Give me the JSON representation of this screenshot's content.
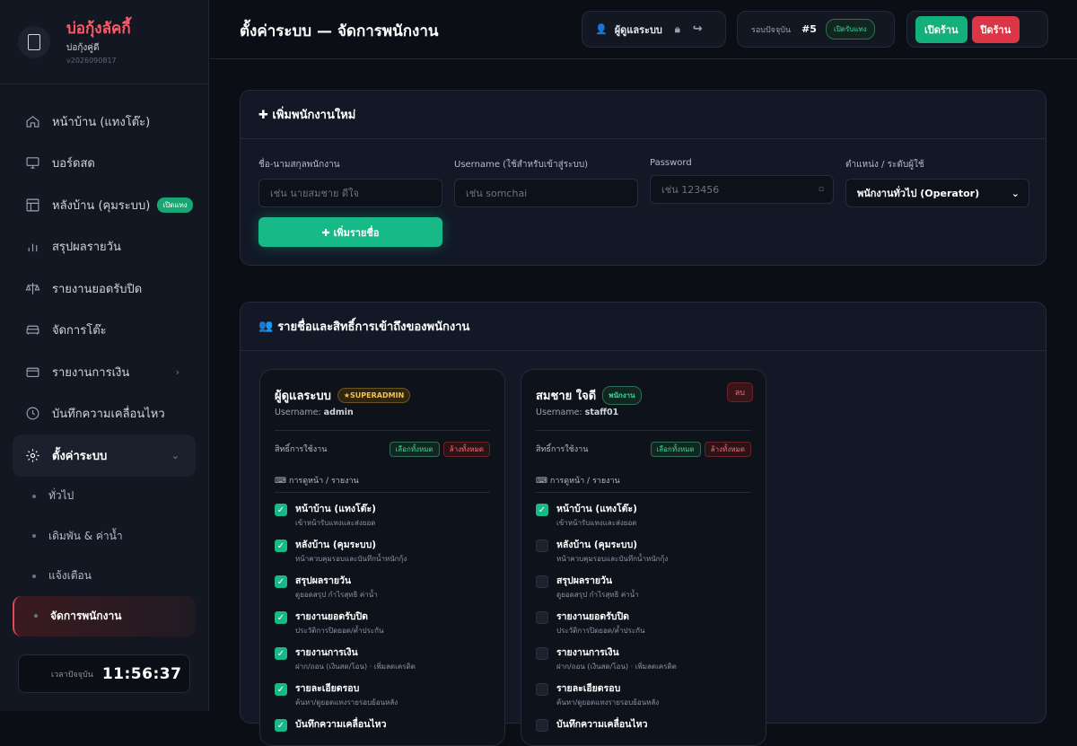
{
  "brand": {
    "title": "บ่อกุ้งลัคกี้",
    "subtitle": "บ่อกุ้งคู่ดี",
    "version": "v2026090817"
  },
  "nav": [
    {
      "label": "หน้าบ้าน (แทงโต๊ะ)",
      "icon": "home-icon"
    },
    {
      "label": "บอร์ดสด",
      "icon": "monitor-icon"
    },
    {
      "label": "หลังบ้าน (คุมระบบ)",
      "icon": "layout-icon",
      "badge": "เปิดแทง"
    },
    {
      "label": "สรุปผลรายวัน",
      "icon": "bar-chart-icon"
    },
    {
      "label": "รายงานยอดรับปิด",
      "icon": "scale-icon"
    },
    {
      "label": "จัดการโต๊ะ",
      "icon": "sofa-icon"
    },
    {
      "label": "รายงานการเงิน",
      "icon": "wallet-icon",
      "chevron": "›"
    },
    {
      "label": "บันทึกความเคลื่อนไหว",
      "icon": "clock-icon"
    },
    {
      "label": "ตั้งค่าระบบ",
      "icon": "gear-icon",
      "chevron": "⌄"
    }
  ],
  "subnav": [
    "ทั่วไป",
    "เดิมพัน & ค่าน้ำ",
    "แจ้งเตือน",
    "จัดการพนักงาน"
  ],
  "clock": {
    "label": "เวลาปัจจุบัน",
    "time": "11:56:37"
  },
  "header": {
    "title": "ตั้งค่าระบบ — จัดการพนักงาน",
    "user": "ผู้ดูแลระบบ",
    "round_label": "รอบปัจจุบัน",
    "round_num": "#5",
    "round_status": "เปิดรับแทง",
    "open_shop": "เปิดร้าน",
    "close_shop": "ปิดร้าน"
  },
  "add_form": {
    "title": "✚ เพิ่มพนักงานใหม่",
    "name_label": "ชื่อ-นามสกุลพนักงาน",
    "name_ph": "เช่น นายสมชาย ดีใจ",
    "user_label": "Username (ใช้สำหรับเข้าสู่ระบบ)",
    "user_ph": "เช่น somchai",
    "pass_label": "Password",
    "pass_ph": "เช่น 123456",
    "role_label": "ตำแหน่ง / ระดับผู้ใช้",
    "role_value": "พนักงานทั่วไป (Operator)",
    "submit": "✚ เพิ่มรายชื่อ"
  },
  "list": {
    "title": "รายชื่อและสิทธิ์การเข้าถึงของพนักงาน"
  },
  "employees": [
    {
      "name": "ผู้ดูแลระบบ",
      "badge": "★SUPERADMIN",
      "username_label": "Username:",
      "username": "admin",
      "perm_label": "สิทธิ์การใช้งาน",
      "select_all": "เลือกทั้งหมด",
      "clear_all": "ล้างทั้งหมด",
      "group": "การดูหน้า / รายงาน",
      "perms": [
        {
          "t": "หน้าบ้าน (แทงโต๊ะ)",
          "d": "เข้าหน้ารับแทงและส่งยอด",
          "on": true
        },
        {
          "t": "หลังบ้าน (คุมระบบ)",
          "d": "หน้าควบคุมรอบและบันทึกน้ำหนักกุ้ง",
          "on": true
        },
        {
          "t": "สรุปผลรายวัน",
          "d": "ดูยอดสรุป กำไรสุทธิ ค่าน้ำ",
          "on": true
        },
        {
          "t": "รายงานยอดรับปิด",
          "d": "ประวัติการปิดยอด/ค้ำประกัน",
          "on": true
        },
        {
          "t": "รายงานการเงิน",
          "d": "ฝาก/ถอน (เงินสด/โอน) · เพิ่มลดเครดิต",
          "on": true
        },
        {
          "t": "รายละเอียดรอบ",
          "d": "ค้นหา/ดูยอดแทงรายรอบย้อนหลัง",
          "on": true
        },
        {
          "t": "บันทึกความเคลื่อนไหว",
          "d": "",
          "on": true
        }
      ]
    },
    {
      "name": "สมชาย ใจดี",
      "badge": "พนักงาน",
      "username_label": "Username:",
      "username": "staff01",
      "delete": "ลบ",
      "perm_label": "สิทธิ์การใช้งาน",
      "select_all": "เลือกทั้งหมด",
      "clear_all": "ล้างทั้งหมด",
      "group": "การดูหน้า / รายงาน",
      "perms": [
        {
          "t": "หน้าบ้าน (แทงโต๊ะ)",
          "d": "เข้าหน้ารับแทงและส่งยอด",
          "on": true
        },
        {
          "t": "หลังบ้าน (คุมระบบ)",
          "d": "หน้าควบคุมรอบและบันทึกน้ำหนักกุ้ง",
          "on": false
        },
        {
          "t": "สรุปผลรายวัน",
          "d": "ดูยอดสรุป กำไรสุทธิ ค่าน้ำ",
          "on": false
        },
        {
          "t": "รายงานยอดรับปิด",
          "d": "ประวัติการปิดยอด/ค้ำประกัน",
          "on": false
        },
        {
          "t": "รายงานการเงิน",
          "d": "ฝาก/ถอน (เงินสด/โอน) · เพิ่มลดเครดิต",
          "on": false
        },
        {
          "t": "รายละเอียดรอบ",
          "d": "ค้นหา/ดูยอดแทงรายรอบย้อนหลัง",
          "on": false
        },
        {
          "t": "บันทึกความเคลื่อนไหว",
          "d": "",
          "on": false
        }
      ]
    }
  ]
}
